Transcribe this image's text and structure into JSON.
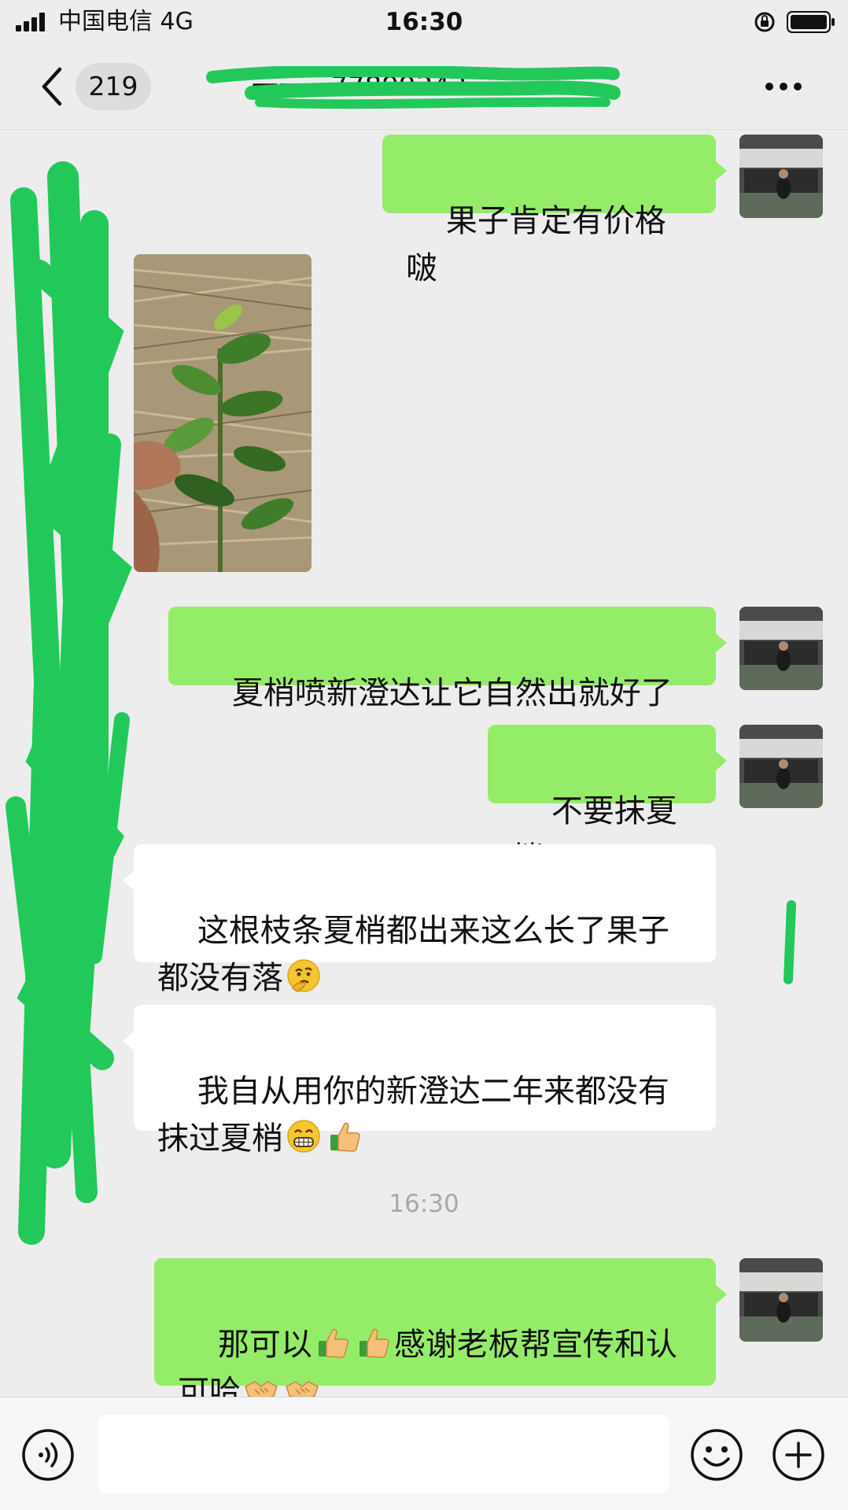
{
  "status_bar": {
    "carrier": "中国电信  4G",
    "time": "16:30"
  },
  "header": {
    "unread_count": "219",
    "title": "一一...77899342"
  },
  "messages": [
    {
      "direction": "out",
      "type": "text",
      "text": "果子肯定有价格啵"
    },
    {
      "direction": "in",
      "type": "image",
      "description": "photo"
    },
    {
      "direction": "out",
      "type": "text",
      "text": "夏梢喷新澄达让它自然出就好了"
    },
    {
      "direction": "out",
      "type": "text",
      "text": "不要抹夏梢"
    },
    {
      "direction": "in",
      "type": "text",
      "text": "这根枝条夏梢都出来这么长了果子\n都没有落",
      "emoji": [
        "thinking-emoji"
      ]
    },
    {
      "direction": "in",
      "type": "text",
      "text_line1": "我自从用你的新澄达二年来都没有",
      "text_line2": "抹过夏梢",
      "emoji": [
        "grin-emoji",
        "thumbs-up-emoji"
      ]
    },
    {
      "direction": "out",
      "type": "text",
      "part1": "那可以",
      "part2": "感谢老板帮宣传和认",
      "part3": "可哈",
      "emoji": [
        "thumbs-up-emoji",
        "thumbs-up-emoji",
        "handshake-emoji",
        "handshake-emoji"
      ]
    }
  ],
  "time_divider": "16:30",
  "input": {
    "placeholder": ""
  },
  "colors": {
    "background": "#ededed",
    "outgoing_bubble": "#95ec69",
    "incoming_bubble": "#ffffff",
    "redaction": "#22c95a"
  }
}
